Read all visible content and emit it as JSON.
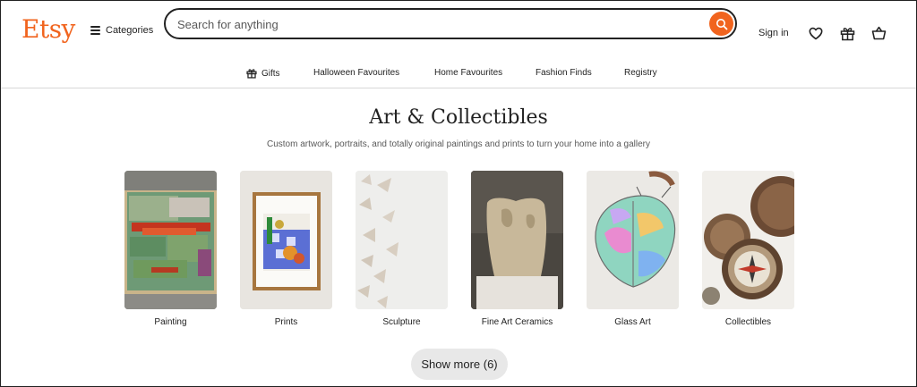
{
  "header": {
    "logo": "Etsy",
    "categories_label": "Categories",
    "search_placeholder": "Search for anything",
    "signin_label": "Sign in",
    "brand_color": "#f1641e"
  },
  "nav": {
    "items": [
      "Gifts",
      "Halloween Favourites",
      "Home Favourites",
      "Fashion Finds",
      "Registry"
    ]
  },
  "main": {
    "title": "Art & Collectibles",
    "subtitle": "Custom artwork, portraits, and totally original paintings and prints to turn your home into a gallery",
    "categories": [
      {
        "label": "Painting",
        "icon": "painting-image"
      },
      {
        "label": "Prints",
        "icon": "print-image"
      },
      {
        "label": "Sculpture",
        "icon": "sculpture-image"
      },
      {
        "label": "Fine Art Ceramics",
        "icon": "ceramics-image"
      },
      {
        "label": "Glass Art",
        "icon": "glass-art-image"
      },
      {
        "label": "Collectibles",
        "icon": "collectibles-image"
      }
    ],
    "show_more_label": "Show more (6)"
  }
}
